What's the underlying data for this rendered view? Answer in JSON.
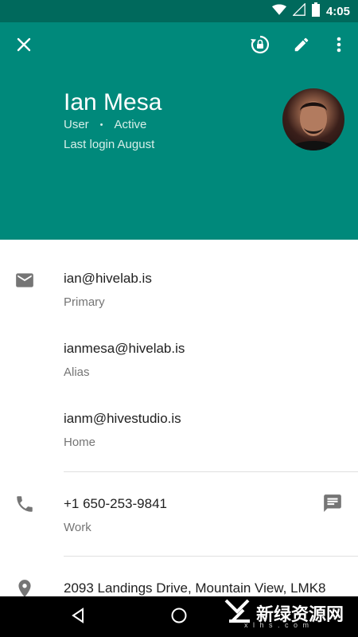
{
  "status_bar": {
    "time": "4:05"
  },
  "header": {
    "name": "Ian Mesa",
    "role": "User",
    "separator": "•",
    "state": "Active",
    "last_login": "Last login August"
  },
  "contact": {
    "emails": [
      {
        "address": "ian@hivelab.is",
        "label": "Primary"
      },
      {
        "address": "ianmesa@hivelab.is",
        "label": "Alias"
      },
      {
        "address": "ianm@hivestudio.is",
        "label": "Home"
      }
    ],
    "phone": {
      "number": "+1 650-253-9841",
      "label": "Work"
    },
    "address": {
      "text": "2093 Landings Drive, Mountain View, LMK8"
    }
  },
  "watermark": {
    "text": "新绿资源网",
    "sub": "x l h s . c o m"
  },
  "colors": {
    "header": "#00897b",
    "status_bar": "#00695c"
  }
}
